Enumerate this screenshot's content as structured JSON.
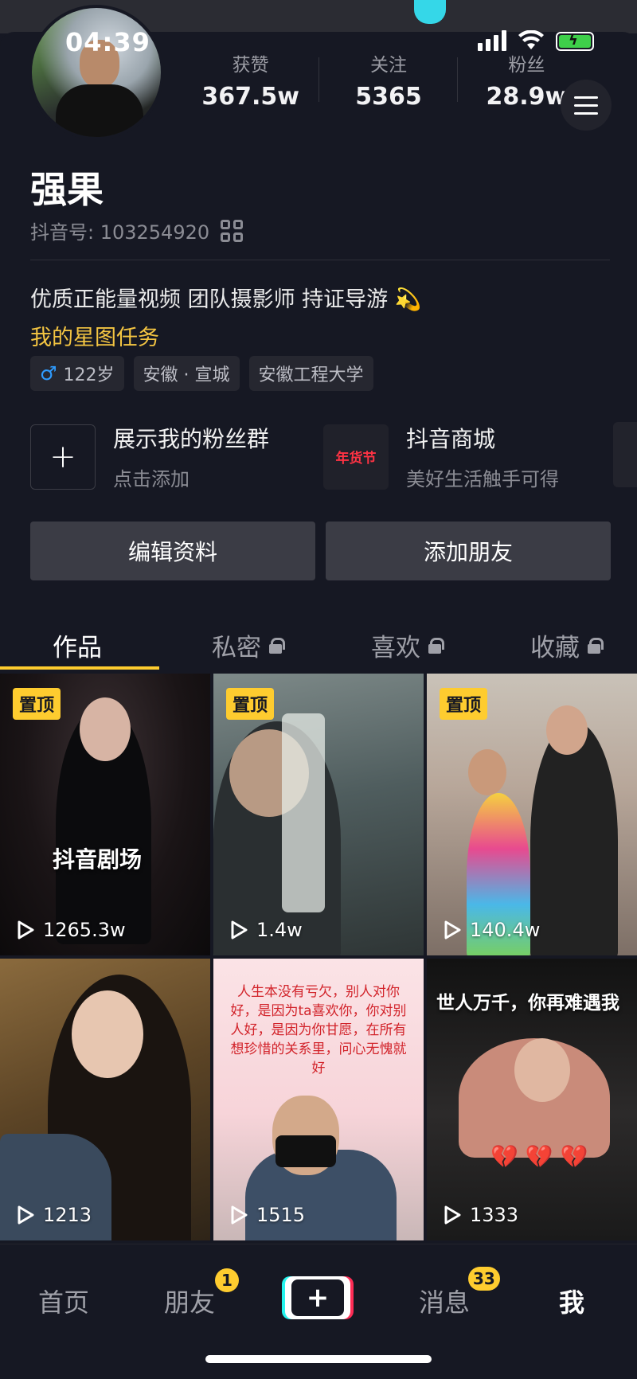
{
  "status_bar": {
    "time": "04:39"
  },
  "profile": {
    "nickname": "强果",
    "douyin_id": "抖音号: 103254920",
    "bio": "优质正能量视频 团队摄影师 持证导游",
    "bio_emoji": "💫",
    "task_link": "我的星图任务",
    "tags": {
      "age": "122岁",
      "location": "安徽 · 宣城",
      "school": "安徽工程大学"
    }
  },
  "stats": [
    {
      "label": "获赞",
      "value": "367.5w"
    },
    {
      "label": "关注",
      "value": "5365"
    },
    {
      "label": "粉丝",
      "value": "28.9w"
    }
  ],
  "shortcuts": {
    "fan_group": {
      "title": "展示我的粉丝群",
      "subtitle": "点击添加",
      "icon": "+"
    },
    "mall": {
      "badge": "年货节",
      "title": "抖音商城",
      "subtitle": "美好生活触手可得"
    }
  },
  "actions": {
    "edit": "编辑资料",
    "add_friend": "添加朋友"
  },
  "tabs": [
    {
      "label": "作品",
      "active": true,
      "locked": false
    },
    {
      "label": "私密",
      "active": false,
      "locked": true
    },
    {
      "label": "喜欢",
      "active": false,
      "locked": true
    },
    {
      "label": "收藏",
      "active": false,
      "locked": true
    }
  ],
  "videos": [
    {
      "pinned": "置顶",
      "plays": "1265.3w",
      "overlay": "抖音剧场"
    },
    {
      "pinned": "置顶",
      "plays": "1.4w",
      "overlay": ""
    },
    {
      "pinned": "置顶",
      "plays": "140.4w",
      "overlay": ""
    },
    {
      "pinned": "",
      "plays": "1213",
      "overlay": ""
    },
    {
      "pinned": "",
      "plays": "1515",
      "overlay": "人生本没有亏欠，别人对你好，是因为ta喜欢你，你对别人好，是因为你甘愿，在所有想珍惜的关系里，问心无愧就好"
    },
    {
      "pinned": "",
      "plays": "1333",
      "overlay": "世人万千，你再难遇我"
    }
  ],
  "bottom_nav": {
    "home": "首页",
    "friends": "朋友",
    "friends_badge": "1",
    "create": "+",
    "messages": "消息",
    "messages_badge": "33",
    "me": "我"
  },
  "colors": {
    "accent": "#fecc2f",
    "background": "#161823",
    "link": "#f4c542"
  }
}
